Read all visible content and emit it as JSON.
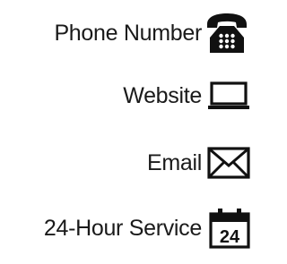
{
  "contacts": [
    {
      "label": "Phone Number",
      "icon": "telephone-icon"
    },
    {
      "label": "Website",
      "icon": "laptop-icon"
    },
    {
      "label": "Email",
      "icon": "envelope-icon"
    },
    {
      "label": "24-Hour Service",
      "icon": "calendar-24-icon",
      "icon_text": "24"
    }
  ],
  "colors": {
    "text": "#1a1a1a",
    "icon": "#111111",
    "background": "#ffffff"
  }
}
